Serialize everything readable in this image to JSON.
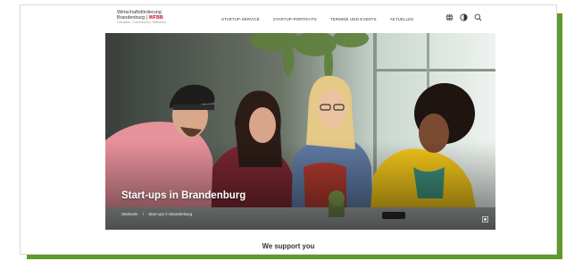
{
  "header": {
    "logo_line1": "Wirtschaftsförderung",
    "logo_line2_prefix": "Brandenburg | ",
    "logo_line2_accent": "WFBB",
    "logo_tagline": "Gestalten. Unterstützen. Mitwirken."
  },
  "nav": {
    "items": [
      {
        "label": "Startup-Service"
      },
      {
        "label": "Startup-Portraits"
      },
      {
        "label": "Termine und Events"
      },
      {
        "label": "Aktuelles"
      }
    ]
  },
  "tools": [
    "language-icon",
    "contrast-icon",
    "search-icon"
  ],
  "hero": {
    "title": "Start-ups in Brandenburg",
    "breadcrumb": {
      "home": "Startseite",
      "separator": "/",
      "current": "Start-ups in Brandenburg"
    }
  },
  "section": {
    "heading": "We support you"
  },
  "colors": {
    "frame_green": "#5f9a2c",
    "brand_red": "#c8102e"
  }
}
